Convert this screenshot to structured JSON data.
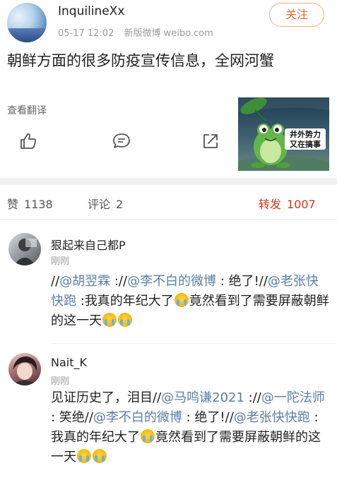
{
  "post": {
    "username": "InquilineXx",
    "timestamp": "05-17 12:02",
    "source": "新版微博 weibo.com",
    "follow_label": "关注",
    "text": "朝鲜方面的很多防疫宣传信息，全网河蟹",
    "translate_label": "查看翻译",
    "image_caption_line1": "井外势力",
    "image_caption_line2": "又在搞事",
    "icons": {
      "like": "thumbs-up-icon",
      "comment": "comment-icon",
      "share": "share-icon"
    }
  },
  "stats": {
    "likes_label": "赞",
    "likes_count": "1138",
    "comments_label": "评论",
    "comments_count": "2",
    "reposts_label": "转发",
    "reposts_count": "1007"
  },
  "comments": [
    {
      "name": "狠起来自己都P",
      "time": "刚刚",
      "parts": [
        {
          "t": "//"
        },
        {
          "m": "@胡翌霖"
        },
        {
          "t": " ://"
        },
        {
          "m": "@李不白的微博"
        },
        {
          "t": " : 绝了!//"
        },
        {
          "m": "@老张快快跑"
        },
        {
          "t": " :我真的年纪大了"
        },
        {
          "e": "cry-emoji"
        },
        {
          "t": "竟然看到了需要屏蔽朝鲜的这一天"
        },
        {
          "e": "cry-emoji"
        },
        {
          "e": "cry-emoji"
        }
      ]
    },
    {
      "name": "Nait_K",
      "time": "刚刚",
      "parts": [
        {
          "t": "见证历史了，泪目//"
        },
        {
          "m": "@马鸣谦2021"
        },
        {
          "t": " ://"
        },
        {
          "m": "@一陀法师"
        },
        {
          "t": " : 笑绝//"
        },
        {
          "m": "@李不白的微博"
        },
        {
          "t": " : 绝了!//"
        },
        {
          "m": "@老张快快跑"
        },
        {
          "t": " :我真的年纪大了"
        },
        {
          "e": "cry-emoji"
        },
        {
          "t": "竟然看到了需要屏蔽朝鲜的这一天"
        },
        {
          "e": "cry-emoji"
        },
        {
          "e": "cry-emoji"
        }
      ]
    }
  ],
  "colors": {
    "mention": "#5b7fa6",
    "follow": "#e8692b",
    "repost": "#d6351a"
  }
}
